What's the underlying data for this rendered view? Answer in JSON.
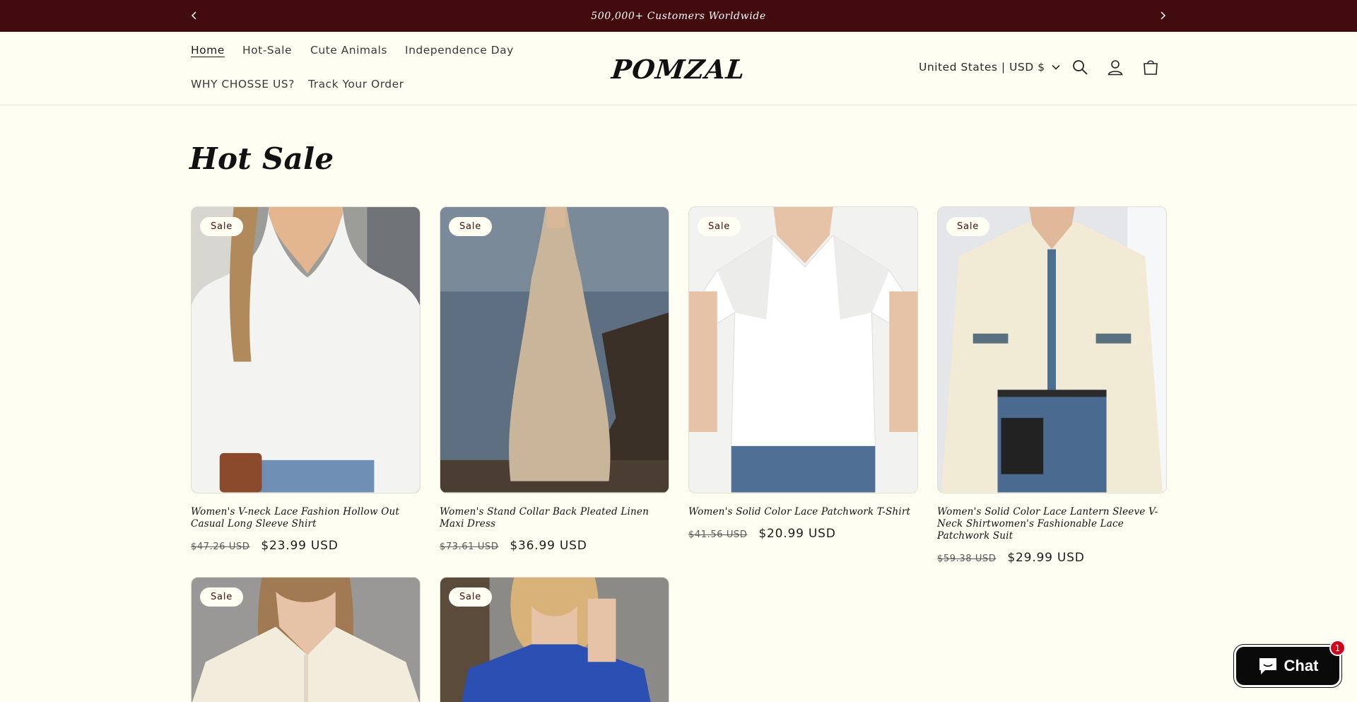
{
  "announcement": {
    "text": "500,000+ Customers Worldwide"
  },
  "nav": {
    "items": [
      "Home",
      "Hot-Sale",
      "Cute Animals",
      "Independence Day",
      "WHY CHOSSE US?",
      "Track Your Order"
    ],
    "active": "Home"
  },
  "logo": "POMZAL",
  "header": {
    "country_selector": "United States | USD $"
  },
  "section": {
    "title": "Hot Sale"
  },
  "products": [
    {
      "badge": "Sale",
      "title": "Women's V-neck Lace Fashion Hollow Out Casual Long Sleeve Shirt",
      "price_old": "$47.26 USD",
      "price_new": "$23.99 USD"
    },
    {
      "badge": "Sale",
      "title": "Women's Stand Collar Back Pleated Linen Maxi Dress",
      "price_old": "$73.61 USD",
      "price_new": "$36.99 USD"
    },
    {
      "badge": "Sale",
      "title": "Women's Solid Color Lace Patchwork T-Shirt",
      "price_old": "$41.56 USD",
      "price_new": "$20.99 USD"
    },
    {
      "badge": "Sale",
      "title": "Women's Solid Color Lace Lantern Sleeve V-Neck Shirtwomen's Fashionable Lace Patchwork Suit",
      "price_old": "$59.38 USD",
      "price_new": "$29.99 USD"
    },
    {
      "badge": "Sale"
    },
    {
      "badge": "Sale"
    }
  ],
  "chat": {
    "label": "Chat",
    "unread": "1"
  },
  "colors": {
    "announcement_bg": "#420c0e",
    "page_bg": "#fffef2",
    "text": "#1c1c1c",
    "chat_badge": "#d3001b"
  },
  "icons": [
    "chevron-left-icon",
    "chevron-right-icon",
    "chevron-down-icon",
    "search-icon",
    "account-icon",
    "cart-icon",
    "chat-bubble-icon"
  ]
}
